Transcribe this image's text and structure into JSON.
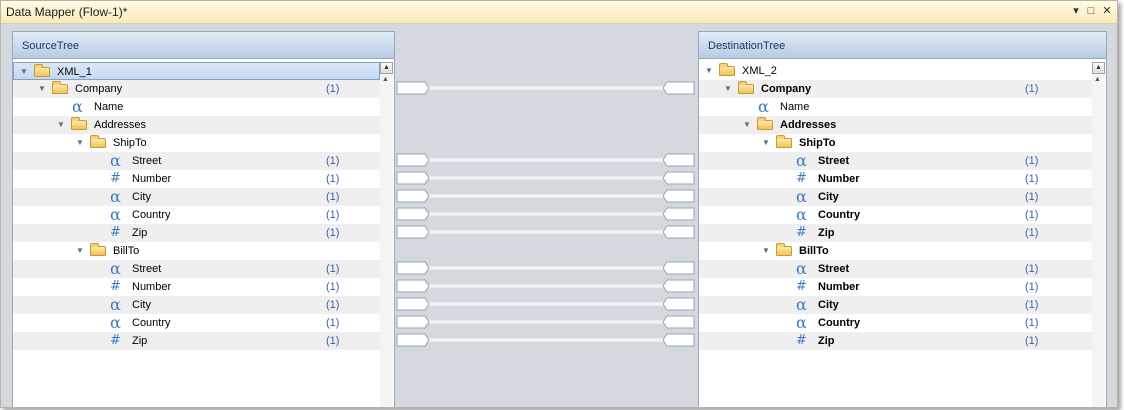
{
  "window": {
    "title": "Data Mapper (Flow-1)*",
    "buttons": {
      "dropdown": "▾",
      "maximize": "□",
      "close": "✕"
    }
  },
  "source": {
    "header": "SourceTree",
    "rows": [
      {
        "label": "XML_1",
        "icon": "folder",
        "level": 0,
        "count": "",
        "bold": false,
        "selected": true
      },
      {
        "label": "Company",
        "icon": "folder",
        "level": 1,
        "count": "(1)",
        "bold": false
      },
      {
        "label": "Name",
        "icon": "alpha",
        "level": 2,
        "count": "",
        "bold": false
      },
      {
        "label": "Addresses",
        "icon": "folder",
        "level": 2,
        "count": "",
        "bold": false
      },
      {
        "label": "ShipTo",
        "icon": "folder",
        "level": 3,
        "count": "",
        "bold": false
      },
      {
        "label": "Street",
        "icon": "alpha",
        "level": 4,
        "count": "(1)",
        "bold": false
      },
      {
        "label": "Number",
        "icon": "hash",
        "level": 4,
        "count": "(1)",
        "bold": false
      },
      {
        "label": "City",
        "icon": "alpha",
        "level": 4,
        "count": "(1)",
        "bold": false
      },
      {
        "label": "Country",
        "icon": "alpha",
        "level": 4,
        "count": "(1)",
        "bold": false
      },
      {
        "label": "Zip",
        "icon": "hash",
        "level": 4,
        "count": "(1)",
        "bold": false
      },
      {
        "label": "BillTo",
        "icon": "folder",
        "level": 3,
        "count": "",
        "bold": false
      },
      {
        "label": "Street",
        "icon": "alpha",
        "level": 4,
        "count": "(1)",
        "bold": false
      },
      {
        "label": "Number",
        "icon": "hash",
        "level": 4,
        "count": "(1)",
        "bold": false
      },
      {
        "label": "City",
        "icon": "alpha",
        "level": 4,
        "count": "(1)",
        "bold": false
      },
      {
        "label": "Country",
        "icon": "alpha",
        "level": 4,
        "count": "(1)",
        "bold": false
      },
      {
        "label": "Zip",
        "icon": "hash",
        "level": 4,
        "count": "(1)",
        "bold": false
      }
    ]
  },
  "destination": {
    "header": "DestinationTree",
    "rows": [
      {
        "label": "XML_2",
        "icon": "folder",
        "level": 0,
        "count": "",
        "bold": false
      },
      {
        "label": "Company",
        "icon": "folder",
        "level": 1,
        "count": "(1)",
        "bold": true
      },
      {
        "label": "Name",
        "icon": "alpha",
        "level": 2,
        "count": "",
        "bold": false
      },
      {
        "label": "Addresses",
        "icon": "folder",
        "level": 2,
        "count": "",
        "bold": true
      },
      {
        "label": "ShipTo",
        "icon": "folder",
        "level": 3,
        "count": "",
        "bold": true
      },
      {
        "label": "Street",
        "icon": "alpha",
        "level": 4,
        "count": "(1)",
        "bold": true
      },
      {
        "label": "Number",
        "icon": "hash",
        "level": 4,
        "count": "(1)",
        "bold": true
      },
      {
        "label": "City",
        "icon": "alpha",
        "level": 4,
        "count": "(1)",
        "bold": true
      },
      {
        "label": "Country",
        "icon": "alpha",
        "level": 4,
        "count": "(1)",
        "bold": true
      },
      {
        "label": "Zip",
        "icon": "hash",
        "level": 4,
        "count": "(1)",
        "bold": true
      },
      {
        "label": "BillTo",
        "icon": "folder",
        "level": 3,
        "count": "",
        "bold": true
      },
      {
        "label": "Street",
        "icon": "alpha",
        "level": 4,
        "count": "(1)",
        "bold": true
      },
      {
        "label": "Number",
        "icon": "hash",
        "level": 4,
        "count": "(1)",
        "bold": true
      },
      {
        "label": "City",
        "icon": "alpha",
        "level": 4,
        "count": "(1)",
        "bold": true
      },
      {
        "label": "Country",
        "icon": "alpha",
        "level": 4,
        "count": "(1)",
        "bold": true
      },
      {
        "label": "Zip",
        "icon": "hash",
        "level": 4,
        "count": "(1)",
        "bold": true
      }
    ]
  },
  "mappings": [
    1,
    5,
    6,
    7,
    8,
    9,
    11,
    12,
    13,
    14,
    15
  ],
  "colors": {
    "workspace": "#d4d9e0",
    "header": "#c8d8ee",
    "accent": "#3b79c3",
    "count": "#3b62a8",
    "titlebar": "#fcf2cd"
  }
}
